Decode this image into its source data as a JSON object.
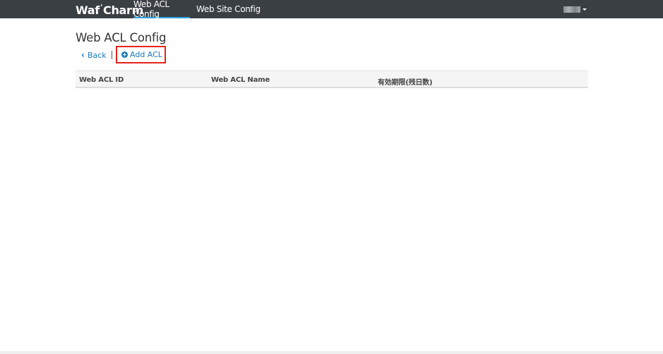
{
  "navbar": {
    "brand_part1": "Waf",
    "brand_apos": "'",
    "brand_part2": "Charm",
    "links": [
      {
        "label": "Web ACL Config",
        "active": true
      },
      {
        "label": "Web Site Config",
        "active": false
      }
    ]
  },
  "page": {
    "title": "Web ACL Config",
    "back_label": "Back",
    "add_label": "Add ACL"
  },
  "table": {
    "columns": [
      "Web ACL ID",
      "Web ACL Name",
      "有効期限(残日数)"
    ],
    "rows": []
  },
  "colors": {
    "navbar_bg": "#3a3f44",
    "link": "#1a7ab8",
    "highlight_box": "#e5231c",
    "active_tab_underline": "#2aa2d8"
  }
}
